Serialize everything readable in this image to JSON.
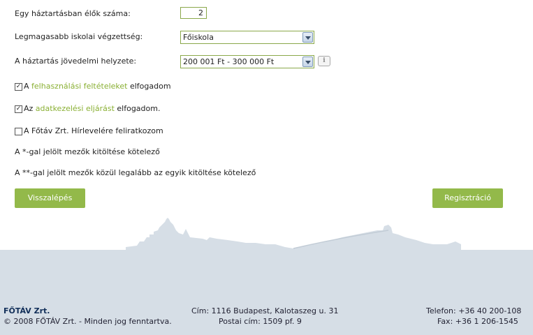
{
  "form": {
    "household_label": "Egy háztartásban élők száma:",
    "household_value": "2",
    "education_label": "Legmagasabb iskolai végzettség:",
    "education_value": "Főiskola",
    "income_label": "A háztartás jövedelmi helyzete:",
    "income_value": "200 001 Ft - 300 000 Ft",
    "info_icon": "i"
  },
  "consents": {
    "terms_prefix": "A ",
    "terms_link": "felhasználási feltételeket",
    "terms_suffix": " elfogadom",
    "terms_checked": true,
    "privacy_prefix": "Az ",
    "privacy_link": "adatkezelési eljárást",
    "privacy_suffix": " elfogadom.",
    "privacy_checked": true,
    "newsletter_text": "A Főtáv Zrt. Hírlevelére feliratkozom",
    "newsletter_checked": false
  },
  "notes": {
    "required_single": "A *-gal jelölt mezők kitöltése kötelező",
    "required_double": "A **-gal jelölt mezők közül legalább az egyik kitöltése kötelező"
  },
  "buttons": {
    "back": "Visszalépés",
    "register": "Regisztráció"
  },
  "footer": {
    "company": "FŐTÁV Zrt.",
    "copyright": "© 2008 FŐTÁV Zrt. - Minden jog fenntartva.",
    "address": "Cím: 1116 Budapest, Kalotaszeg u. 31",
    "postal": "Postai cím: 1509 pf. 9",
    "phone": "Telefon: +36 40 200-108",
    "fax": "Fax: +36 1 206-1545"
  },
  "colors": {
    "accent": "#93b94a",
    "link": "#8ab034",
    "footer_bg": "#d6dee6",
    "skyline": "#c9d3dd"
  },
  "icons": {
    "checkbox_checked": "check-icon",
    "select_arrow": "chevron-down-icon",
    "info": "info-icon"
  }
}
